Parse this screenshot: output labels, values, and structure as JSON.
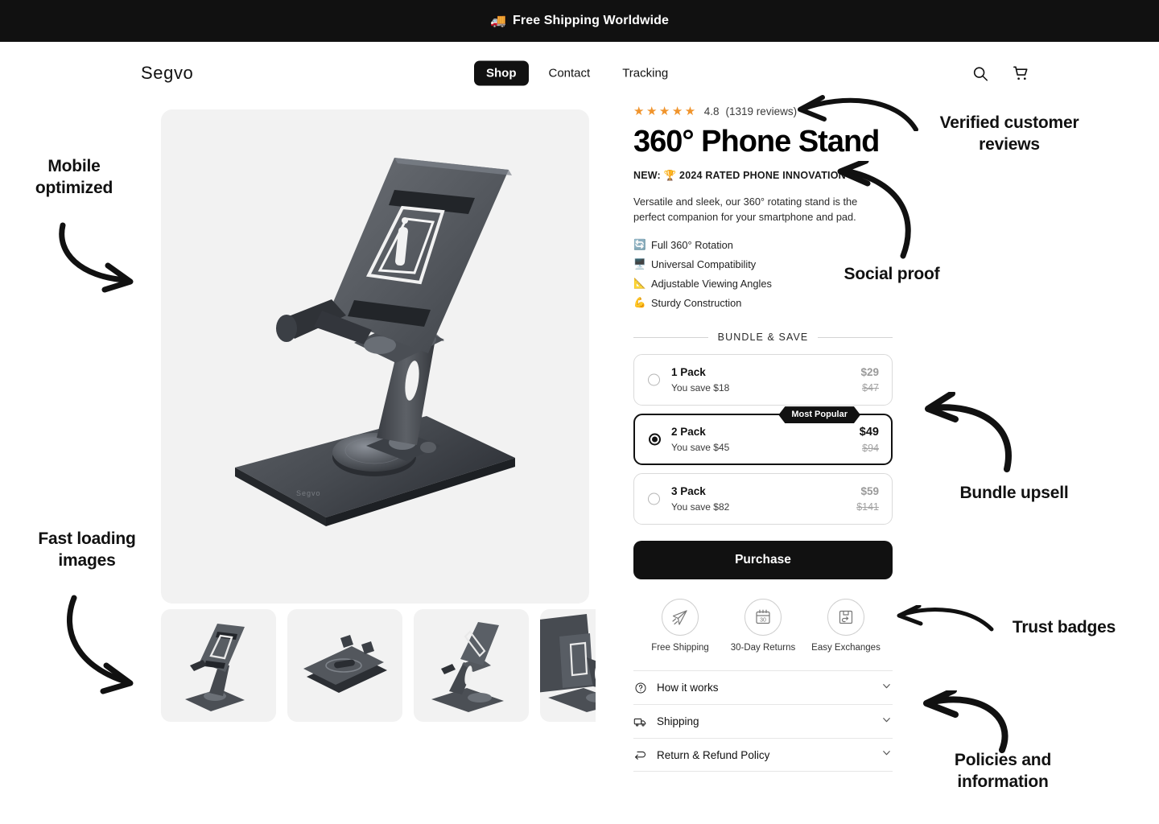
{
  "announcement": {
    "emoji": "🚚",
    "text": "Free Shipping Worldwide"
  },
  "header": {
    "logo": "Segvo",
    "nav": [
      {
        "label": "Shop",
        "active": true
      },
      {
        "label": "Contact",
        "active": false
      },
      {
        "label": "Tracking",
        "active": false
      }
    ],
    "icons": {
      "search": "search-icon",
      "cart": "cart-icon"
    }
  },
  "product": {
    "rating": {
      "stars": "★★★★★",
      "value": "4.8",
      "reviews": "(1319 reviews)",
      "star_color": "#f0942c"
    },
    "title": "360° Phone Stand",
    "new_label": "NEW:",
    "new_trophy": "🏆",
    "new_text": "2024 RATED PHONE INNOVATION",
    "description": "Versatile and sleek, our 360° rotating stand is the perfect companion for your smartphone and pad.",
    "features": [
      {
        "icon": "🔄",
        "label": "Full 360° Rotation"
      },
      {
        "icon": "🖥️",
        "label": "Universal Compatibility"
      },
      {
        "icon": "📐",
        "label": "Adjustable Viewing Angles"
      },
      {
        "icon": "💪",
        "label": "Sturdy Construction"
      }
    ]
  },
  "bundle": {
    "heading": "BUNDLE & SAVE",
    "popular_badge": "Most Popular",
    "options": [
      {
        "name": "1 Pack",
        "save": "You save $18",
        "price": "$29",
        "compare": "$47",
        "selected": false
      },
      {
        "name": "2 Pack",
        "save": "You save $45",
        "price": "$49",
        "compare": "$94",
        "selected": true
      },
      {
        "name": "3 Pack",
        "save": "You save $82",
        "price": "$59",
        "compare": "$141",
        "selected": false
      }
    ],
    "cta": "Purchase"
  },
  "trust_badges": [
    {
      "icon": "paper-plane-icon",
      "label": "Free Shipping"
    },
    {
      "icon": "calendar-30-icon",
      "label": "30-Day Returns"
    },
    {
      "icon": "box-return-icon",
      "label": "Easy Exchanges"
    }
  ],
  "accordions": [
    {
      "icon": "question-circle-icon",
      "label": "How it works"
    },
    {
      "icon": "truck-icon",
      "label": "Shipping"
    },
    {
      "icon": "return-arrow-icon",
      "label": "Return & Refund Policy"
    }
  ],
  "annotations": {
    "mobile": "Mobile optimized",
    "fast": "Fast loading images",
    "verified": "Verified customer reviews",
    "social": "Social proof",
    "bundle": "Bundle upsell",
    "trust": "Trust badges",
    "policies": "Policies and information"
  },
  "gallery": {
    "thumbnails": [
      {
        "view": "front-angle"
      },
      {
        "view": "folded-flat"
      },
      {
        "view": "side-angle"
      },
      {
        "view": "rear-angle"
      }
    ]
  },
  "colors": {
    "accent_star": "#f0942c",
    "dark": "#111111",
    "panel": "#f2f2f2"
  }
}
